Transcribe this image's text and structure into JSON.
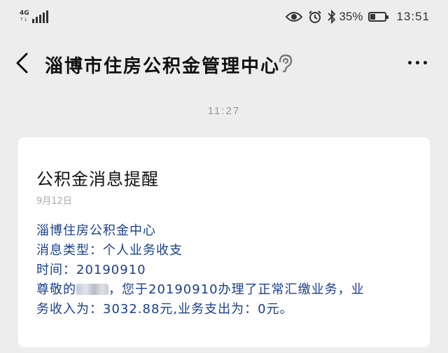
{
  "status_bar": {
    "network": "4G",
    "network_sub": "↑↓",
    "battery_percent": "35%",
    "battery_level": 0.35,
    "time": "13:51"
  },
  "header": {
    "title": "淄博市住房公积金管理中心"
  },
  "chat": {
    "timestamp": "11:27"
  },
  "card": {
    "title": "公积金消息提醒",
    "date": "9月12日",
    "lines": [
      "淄博住房公积金中心",
      "消息类型：个人业务收支",
      "时间：20190910"
    ],
    "line4_prefix": "尊敬的",
    "line4_suffix": "，您于20190910办理了正常汇缴业务，业",
    "line5": "务收入为：3032.88元,业务支出为：0元。"
  },
  "colors": {
    "background": "#ededed",
    "card": "#ffffff",
    "content_text": "#1a3f8c"
  }
}
